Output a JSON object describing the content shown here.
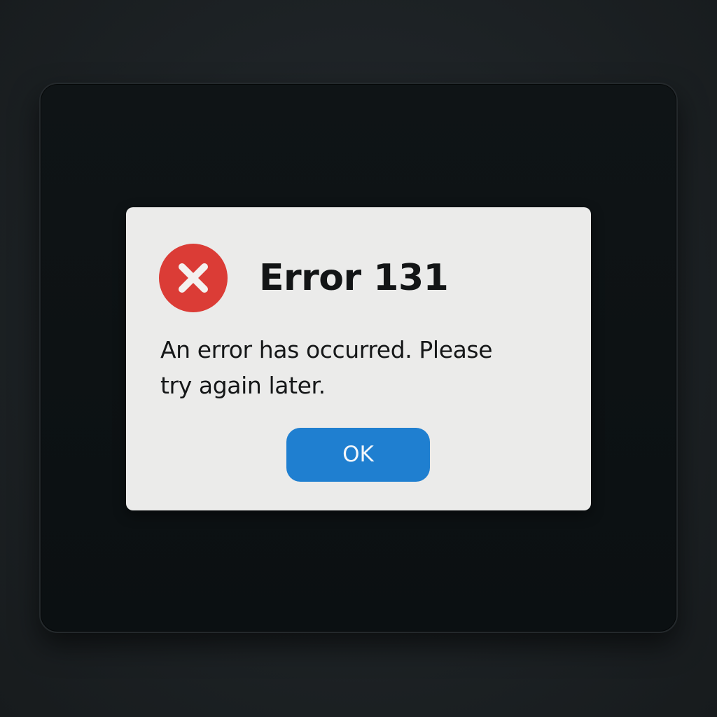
{
  "dialog": {
    "icon": "error-x-icon",
    "title": "Error 131",
    "message": "An error has occurred. Please try again later.",
    "ok_label": "OK"
  },
  "colors": {
    "background": "#1d2225",
    "screen": "#0d1214",
    "dialog_background": "#ebebea",
    "error_red": "#db3c36",
    "button_blue": "#1f7fd0",
    "text": "#131516"
  }
}
